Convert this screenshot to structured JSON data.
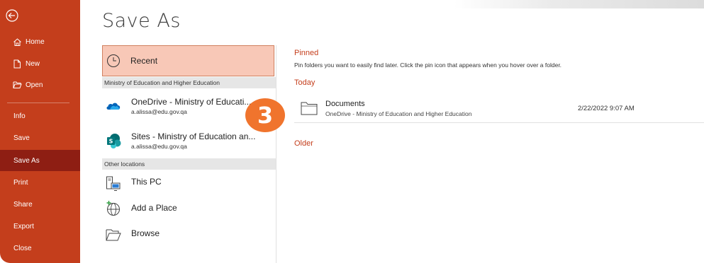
{
  "sidebar": {
    "items": [
      {
        "label": "Home",
        "icon": "home-icon"
      },
      {
        "label": "New",
        "icon": "new-document-icon"
      },
      {
        "label": "Open",
        "icon": "open-folder-icon"
      },
      {
        "label": "Info"
      },
      {
        "label": "Save"
      },
      {
        "label": "Save As",
        "active": true
      },
      {
        "label": "Print"
      },
      {
        "label": "Share"
      },
      {
        "label": "Export"
      },
      {
        "label": "Close"
      }
    ],
    "bg_color": "#c43e1c",
    "active_color": "#8e1e13"
  },
  "page_title": "Save As",
  "locations": {
    "recent_label": "Recent",
    "org_section": "Ministry of Education and Higher Education",
    "onedrive": {
      "title": "OneDrive - Ministry of Educati...",
      "email": "a.alissa@edu.gov.qa"
    },
    "sites": {
      "title": "Sites - Ministry of Education an...",
      "email": "a.alissa@edu.gov.qa"
    },
    "other_section": "Other locations",
    "this_pc": "This PC",
    "add_place": "Add a Place",
    "browse": "Browse"
  },
  "badge": "3",
  "right": {
    "pinned_label": "Pinned",
    "pinned_desc": "Pin folders you want to easily find later. Click the pin icon that appears when you hover over a folder.",
    "today_label": "Today",
    "file": {
      "name": "Documents",
      "path": "OneDrive - Ministry of Education and Higher Education",
      "date": "2/22/2022 9:07 AM"
    },
    "older_label": "Older"
  },
  "colors": {
    "accent": "#c43e1c",
    "recent_highlight": "#f8c8b7",
    "badge": "#f0742d"
  }
}
